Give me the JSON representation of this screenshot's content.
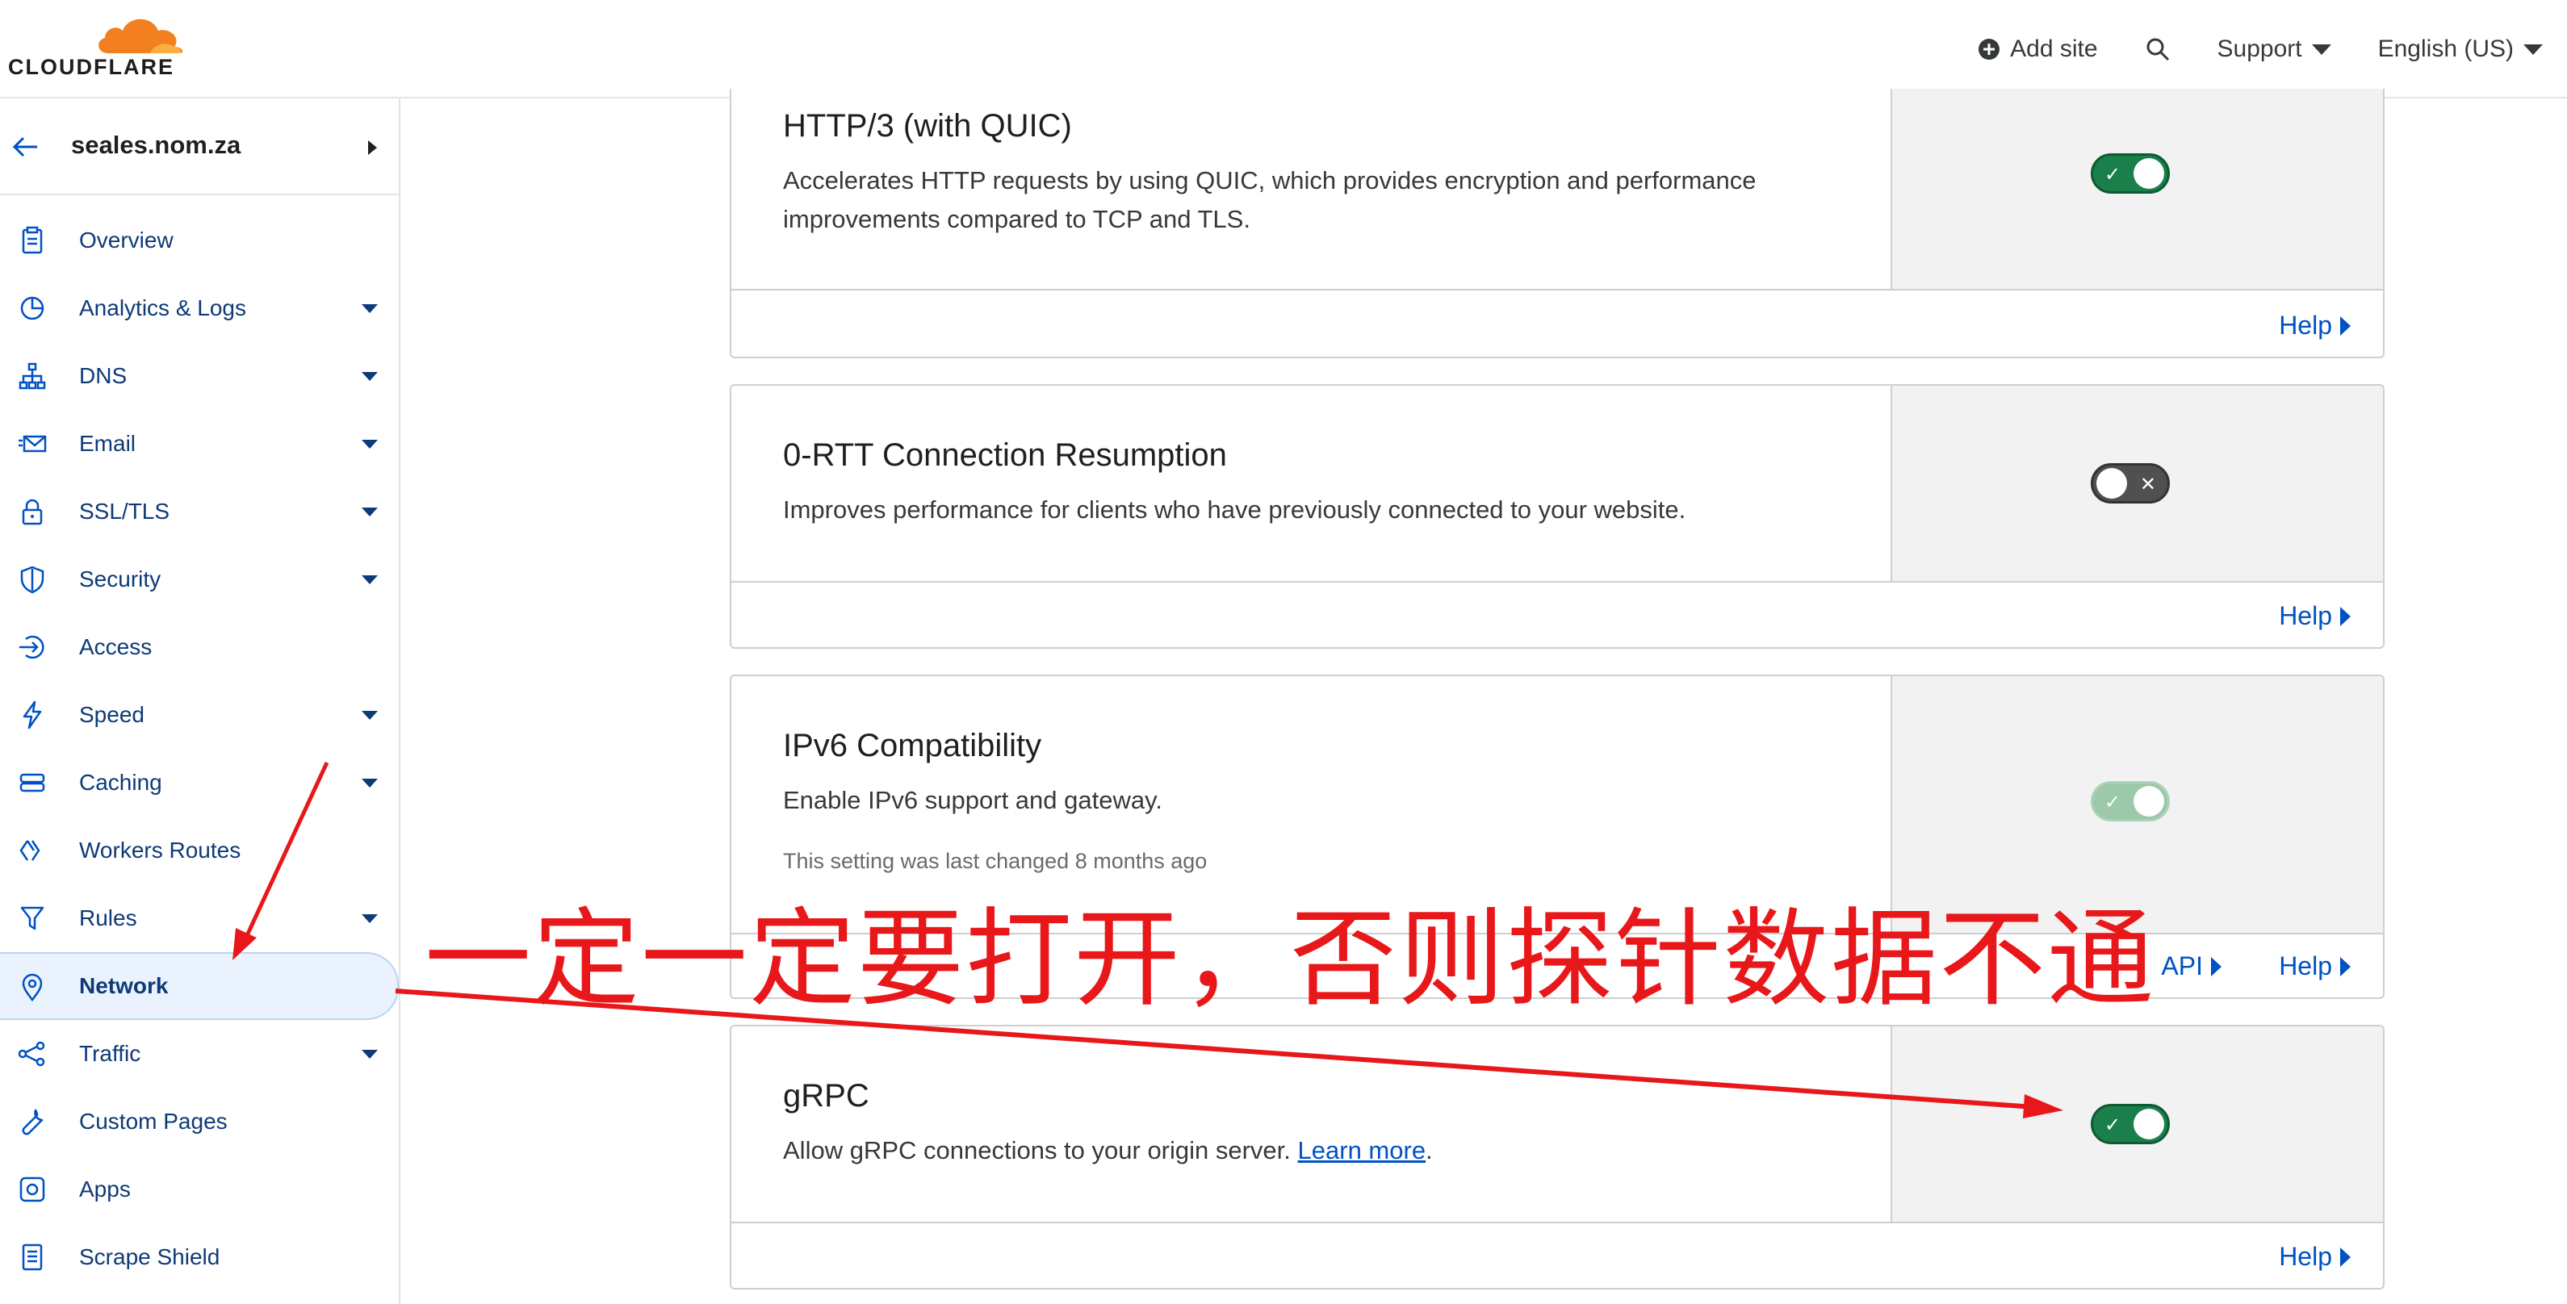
{
  "brand": {
    "name": "CLOUDFLARE",
    "accent": "#f38020"
  },
  "header": {
    "add_site": "Add site",
    "support": "Support",
    "language": "English (US)"
  },
  "sidebar": {
    "site": "seales.nom.za",
    "items": [
      {
        "label": "Overview",
        "icon": "clipboard-icon",
        "dropdown": false
      },
      {
        "label": "Analytics & Logs",
        "icon": "pie-chart-icon",
        "dropdown": true
      },
      {
        "label": "DNS",
        "icon": "network-tree-icon",
        "dropdown": true
      },
      {
        "label": "Email",
        "icon": "envelope-icon",
        "dropdown": true
      },
      {
        "label": "SSL/TLS",
        "icon": "lock-icon",
        "dropdown": true
      },
      {
        "label": "Security",
        "icon": "shield-icon",
        "dropdown": true
      },
      {
        "label": "Access",
        "icon": "access-icon",
        "dropdown": false
      },
      {
        "label": "Speed",
        "icon": "lightning-icon",
        "dropdown": true
      },
      {
        "label": "Caching",
        "icon": "server-icon",
        "dropdown": true
      },
      {
        "label": "Workers Routes",
        "icon": "workers-icon",
        "dropdown": false
      },
      {
        "label": "Rules",
        "icon": "filter-icon",
        "dropdown": true
      },
      {
        "label": "Network",
        "icon": "location-pin-icon",
        "dropdown": false,
        "active": true
      },
      {
        "label": "Traffic",
        "icon": "traffic-icon",
        "dropdown": true
      },
      {
        "label": "Custom Pages",
        "icon": "wrench-icon",
        "dropdown": false
      },
      {
        "label": "Apps",
        "icon": "apps-icon",
        "dropdown": false
      },
      {
        "label": "Scrape Shield",
        "icon": "document-icon",
        "dropdown": false
      }
    ]
  },
  "cards": {
    "http3": {
      "title": "HTTP/3 (with QUIC)",
      "desc": "Accelerates HTTP requests by using QUIC, which provides encryption and performance improvements compared to TCP and TLS.",
      "enabled": true,
      "help": "Help"
    },
    "rtt": {
      "title": "0-RTT Connection Resumption",
      "desc": "Improves performance for clients who have previously connected to your website.",
      "enabled": false,
      "help": "Help"
    },
    "ipv6": {
      "title": "IPv6 Compatibility",
      "desc": "Enable IPv6 support and gateway.",
      "note": "This setting was last changed 8 months ago",
      "enabled": true,
      "disabled": true,
      "api": "API",
      "help": "Help"
    },
    "grpc": {
      "title": "gRPC",
      "desc": "Allow gRPC connections to your origin server.",
      "learn_more": "Learn more",
      "enabled": true,
      "help": "Help"
    }
  },
  "annotation": {
    "text": "一定一定要打开，否则探针数据不通",
    "color": "#e8171a"
  }
}
